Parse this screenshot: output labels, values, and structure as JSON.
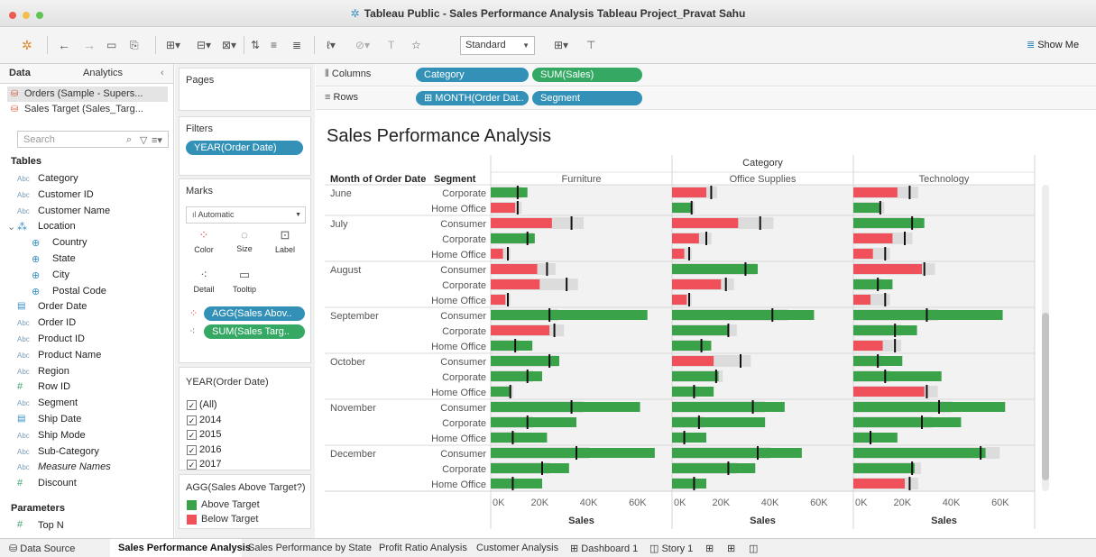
{
  "window": {
    "title": "Tableau Public - Sales Performance Analysis Tableau Project_Pravat Sahu"
  },
  "toolbar": {
    "standard": "Standard",
    "show_me": "Show Me"
  },
  "data_pane": {
    "tab_data": "Data",
    "tab_analytics": "Analytics",
    "sources": [
      "Orders (Sample - Supers...",
      "Sales Target (Sales_Targ..."
    ],
    "search_placeholder": "Search",
    "tables_header": "Tables",
    "fields": [
      {
        "type": "Abc",
        "name": "Category"
      },
      {
        "type": "Abc",
        "name": "Customer ID"
      },
      {
        "type": "Abc",
        "name": "Customer Name"
      },
      {
        "type": "geo",
        "name": "Location"
      },
      {
        "type": "geo",
        "name": "Country"
      },
      {
        "type": "geo",
        "name": "State"
      },
      {
        "type": "geo",
        "name": "City"
      },
      {
        "type": "geo",
        "name": "Postal Code"
      },
      {
        "type": "cal",
        "name": "Order Date"
      },
      {
        "type": "Abc",
        "name": "Order ID"
      },
      {
        "type": "Abc",
        "name": "Product ID"
      },
      {
        "type": "Abc",
        "name": "Product Name"
      },
      {
        "type": "Abc",
        "name": "Region"
      },
      {
        "type": "#",
        "name": "Row ID"
      },
      {
        "type": "Abc",
        "name": "Segment"
      },
      {
        "type": "cal",
        "name": "Ship Date"
      },
      {
        "type": "Abc",
        "name": "Ship Mode"
      },
      {
        "type": "Abc",
        "name": "Sub-Category"
      },
      {
        "type": "Abc",
        "name": "Measure Names"
      },
      {
        "type": "#",
        "name": "Discount"
      }
    ],
    "parameters_header": "Parameters",
    "parameter": {
      "type": "#",
      "name": "Top N"
    }
  },
  "pages": {
    "title": "Pages"
  },
  "filters": {
    "title": "Filters",
    "pill": "YEAR(Order Date)"
  },
  "marks": {
    "title": "Marks",
    "type": "Automatic",
    "color": "Color",
    "size": "Size",
    "label": "Label",
    "detail": "Detail",
    "tooltip": "Tooltip",
    "pill1": "AGG(Sales Abov..",
    "pill2": "SUM(Sales Targ.."
  },
  "year_filter": {
    "title": "YEAR(Order Date)",
    "options": [
      "(All)",
      "2014",
      "2015",
      "2016",
      "2017"
    ]
  },
  "legend": {
    "title": "AGG(Sales Above Target?)",
    "above": "Above Target",
    "below": "Below Target",
    "above_color": "#3aa34a",
    "below_color": "#f0505a"
  },
  "shelves": {
    "columns_label": "Columns",
    "rows_label": "Rows",
    "col_pills": [
      "Category",
      "SUM(Sales)"
    ],
    "row_pills": [
      "MONTH(Order Dat..",
      "Segment"
    ]
  },
  "viz": {
    "title": "Sales Performance Analysis",
    "category_header": "Category",
    "month_header": "Month of Order Date",
    "segment_header": "Segment"
  },
  "chart_data": {
    "type": "bar",
    "categories": [
      "Furniture",
      "Office Supplies",
      "Technology"
    ],
    "xlim": [
      0,
      70000
    ],
    "ticks": [
      "0K",
      "20K",
      "40K",
      "60K"
    ],
    "xlabel": "Sales",
    "rows": [
      {
        "month": "June",
        "segment": "Corporate",
        "values": [
          15000,
          14000,
          18000
        ],
        "targets": [
          11000,
          16000,
          23000
        ]
      },
      {
        "month": "",
        "segment": "Home Office",
        "values": [
          10000,
          8000,
          11000
        ],
        "targets": [
          11000,
          8000,
          11000
        ]
      },
      {
        "month": "July",
        "segment": "Consumer",
        "values": [
          25000,
          27000,
          29000
        ],
        "targets": [
          33000,
          36000,
          24000
        ]
      },
      {
        "month": "",
        "segment": "Corporate",
        "values": [
          18000,
          11000,
          16000
        ],
        "targets": [
          15000,
          14000,
          21000
        ]
      },
      {
        "month": "",
        "segment": "Home Office",
        "values": [
          5000,
          5000,
          8000
        ],
        "targets": [
          7000,
          7000,
          13000
        ]
      },
      {
        "month": "August",
        "segment": "Consumer",
        "values": [
          19000,
          35000,
          28000
        ],
        "targets": [
          23000,
          30000,
          29000
        ]
      },
      {
        "month": "",
        "segment": "Corporate",
        "values": [
          20000,
          20000,
          16000
        ],
        "targets": [
          31000,
          22000,
          10000
        ]
      },
      {
        "month": "",
        "segment": "Home Office",
        "values": [
          6000,
          6000,
          7000
        ],
        "targets": [
          7000,
          7000,
          13000
        ]
      },
      {
        "month": "September",
        "segment": "Consumer",
        "values": [
          64000,
          58000,
          61000
        ],
        "targets": [
          24000,
          41000,
          30000
        ]
      },
      {
        "month": "",
        "segment": "Corporate",
        "values": [
          24000,
          23000,
          26000
        ],
        "targets": [
          26000,
          23000,
          17000
        ]
      },
      {
        "month": "",
        "segment": "Home Office",
        "values": [
          17000,
          16000,
          12000
        ],
        "targets": [
          10000,
          12000,
          17000
        ]
      },
      {
        "month": "October",
        "segment": "Consumer",
        "values": [
          28000,
          17000,
          20000
        ],
        "targets": [
          24000,
          28000,
          10000
        ]
      },
      {
        "month": "",
        "segment": "Corporate",
        "values": [
          21000,
          19000,
          36000
        ],
        "targets": [
          15000,
          18000,
          13000
        ]
      },
      {
        "month": "",
        "segment": "Home Office",
        "values": [
          8000,
          17000,
          29000
        ],
        "targets": [
          8000,
          9000,
          30000
        ]
      },
      {
        "month": "November",
        "segment": "Consumer",
        "values": [
          61000,
          46000,
          62000
        ],
        "targets": [
          33000,
          33000,
          35000
        ]
      },
      {
        "month": "",
        "segment": "Corporate",
        "values": [
          35000,
          38000,
          44000
        ],
        "targets": [
          15000,
          11000,
          28000
        ]
      },
      {
        "month": "",
        "segment": "Home Office",
        "values": [
          23000,
          14000,
          18000
        ],
        "targets": [
          9000,
          5000,
          7000
        ]
      },
      {
        "month": "December",
        "segment": "Consumer",
        "values": [
          67000,
          53000,
          54000
        ],
        "targets": [
          35000,
          35000,
          52000
        ]
      },
      {
        "month": "",
        "segment": "Corporate",
        "values": [
          32000,
          34000,
          25000
        ],
        "targets": [
          21000,
          23000,
          24000
        ]
      },
      {
        "month": "",
        "segment": "Home Office",
        "values": [
          21000,
          14000,
          21000
        ],
        "targets": [
          9000,
          9000,
          23000
        ]
      }
    ]
  },
  "sheet_tabs": {
    "data_source": "Data Source",
    "tabs": [
      "Sales Performance Analysis",
      "Sales Performance by State",
      "Profit Ratio Analysis",
      "Customer Analysis",
      "Dashboard 1",
      "Story 1"
    ]
  }
}
